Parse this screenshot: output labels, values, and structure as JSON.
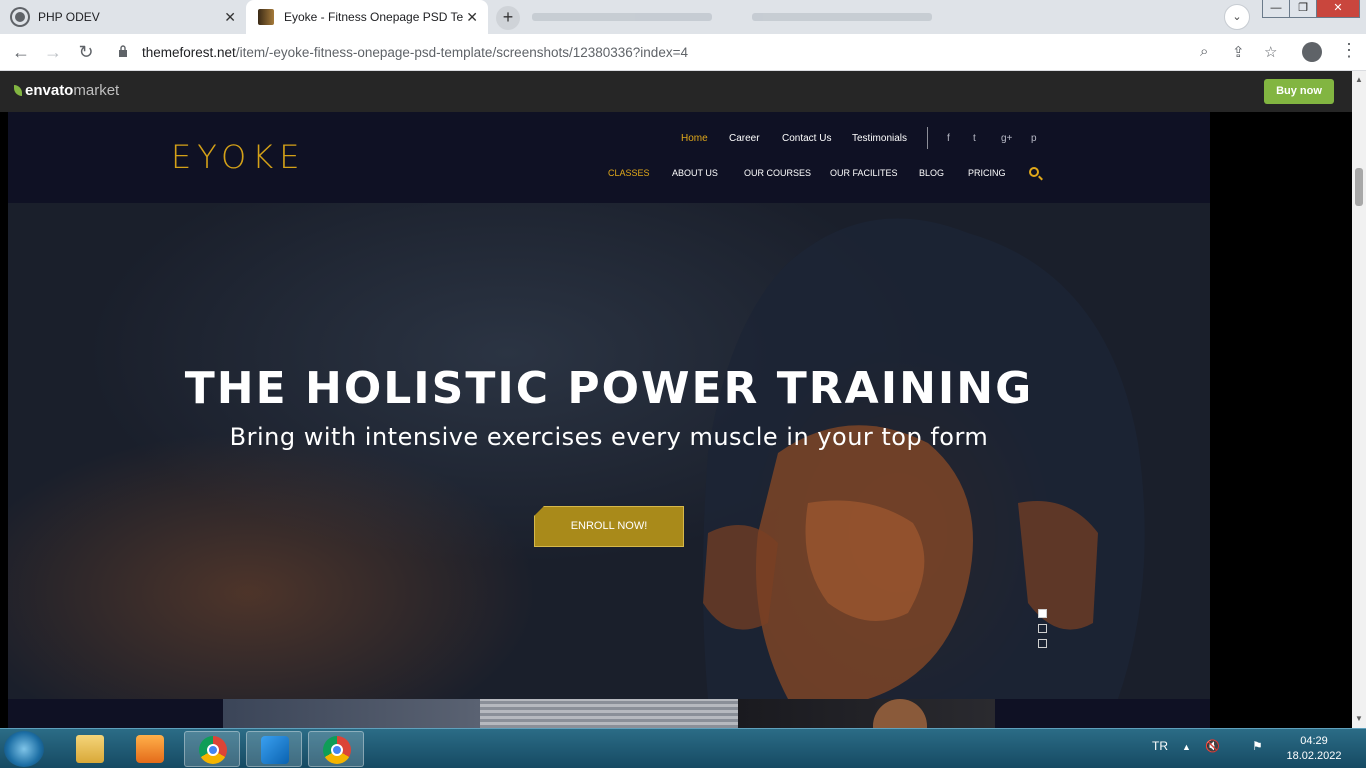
{
  "browser": {
    "tabs": [
      {
        "title": "PHP ODEV",
        "active": false
      },
      {
        "title": "Eyoke - Fitness Onepage PSD Ter",
        "active": true
      }
    ],
    "new_tab_label": "+",
    "close_glyph": "✕",
    "url_host": "themeforest.net",
    "url_path": "/item/-eyoke-fitness-onepage-psd-template/screenshots/12380336?index=4"
  },
  "envato": {
    "logo_word": "envato",
    "logo_market": "market",
    "buy_label": "Buy now",
    "accent": "#82b541"
  },
  "site": {
    "logo": "EYOKE",
    "accent": "#e0a81a",
    "top_nav": [
      "Home",
      "Career",
      "Contact Us",
      "Testimonials"
    ],
    "social": [
      "f",
      "t",
      "g+",
      "p"
    ],
    "main_nav": [
      "CLASSES",
      "ABOUT US",
      "OUR COURSES",
      "OUR FACILITES",
      "BLOG",
      "PRICING"
    ],
    "hero_title": "THE HOLISTIC POWER TRAINING",
    "hero_subtitle": "Bring with intensive exercises every muscle in your top form",
    "cta_label": "ENROLL NOW!",
    "slider_dots": 3,
    "active_dot": 0
  },
  "taskbar": {
    "language": "TR",
    "time": "04:29",
    "date": "18.02.2022"
  }
}
